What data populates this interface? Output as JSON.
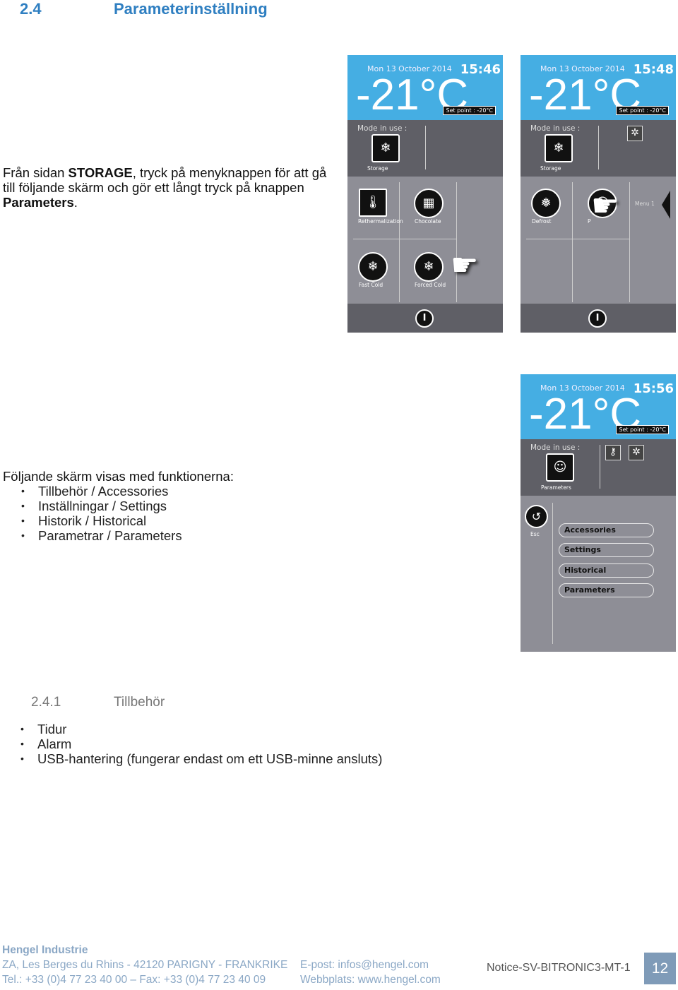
{
  "section": {
    "number": "2.4",
    "title": "Parameterinställning"
  },
  "intro": {
    "pre": "Från sidan ",
    "bold1": "STORAGE",
    "mid": ", tryck på menyknappen för att gå till följande skärm och gör ett långt tryck på knappen ",
    "bold2": "Parameters",
    "end": "."
  },
  "functions": {
    "intro": "Följande skärm visas med funktionerna:",
    "items": [
      "Tillbehör / Accessories",
      "Inställningar / Settings",
      "Historik / Historical",
      "Parametrar / Parameters"
    ]
  },
  "subsection": {
    "number": "2.4.1",
    "title": "Tillbehör",
    "items": [
      "Tidur",
      "Alarm",
      "USB-hantering (fungerar endast om ett USB-minne ansluts)"
    ]
  },
  "screens": [
    {
      "date": "Mon 13 October 2014",
      "time": "15:46",
      "temp": "-21°C",
      "setpoint": "Set point : -20°C",
      "mode_label": "Mode in use :",
      "mode": "Storage",
      "buttons": [
        "Rethermalization",
        "Chocolate",
        "Fast Cold",
        "Forced Cold"
      ]
    },
    {
      "date": "Mon 13 October 2014",
      "time": "15:48",
      "temp": "-21°C",
      "setpoint": "Set point : -20°C",
      "mode_label": "Mode in use :",
      "mode": "Storage",
      "buttons": [
        "Defrost",
        "P"
      ],
      "menu": "Menu 1"
    },
    {
      "date": "Mon 13 October 2014",
      "time": "15:56",
      "temp": "-21°C",
      "setpoint": "Set point : -20°C",
      "mode_label": "Mode in use :",
      "mode": "Parameters",
      "esc": "Esc",
      "menu_items": [
        "Accessories",
        "Settings",
        "Historical",
        "Parameters"
      ]
    }
  ],
  "footer": {
    "company": "Hengel Industrie",
    "address": "ZA, Les Berges du Rhins - 42120 PARIGNY - FRANKRIKE",
    "phone": "Tel.: +33 (0)4 77 23 40 00 – Fax: +33 (0)4 77 23 40 09",
    "email": "E-post: infos@hengel.com",
    "web": "Webbplats: www.hengel.com",
    "doc": "Notice-SV-BITRONIC3-MT-1",
    "page": "12"
  },
  "colors": {
    "accent": "#2f7fc1",
    "screen_header": "#45aee3",
    "page_box": "#7f9bb8"
  }
}
